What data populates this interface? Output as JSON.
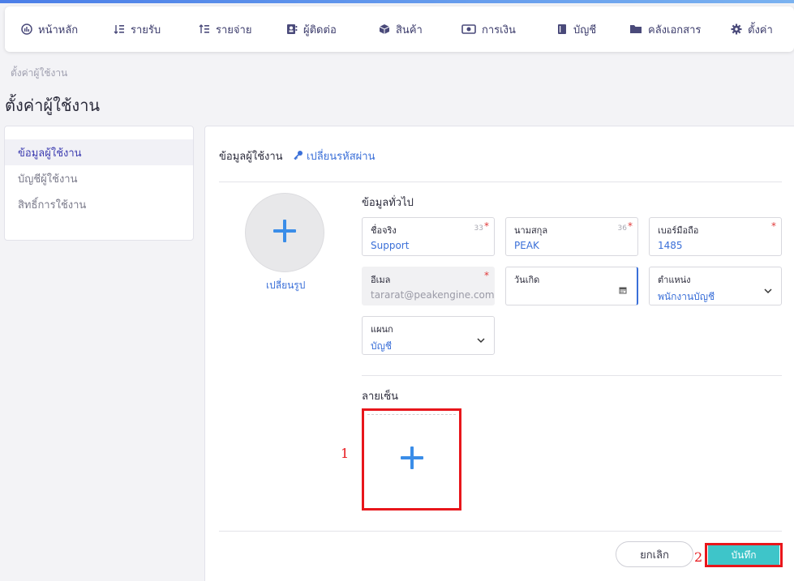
{
  "nav": {
    "items": [
      {
        "label": "หน้าหลัก",
        "icon": "dashboard-icon"
      },
      {
        "label": "รายรับ",
        "icon": "income-list-icon"
      },
      {
        "label": "รายจ่าย",
        "icon": "expense-list-icon"
      },
      {
        "label": "ผู้ติดต่อ",
        "icon": "contacts-icon"
      },
      {
        "label": "สินค้า",
        "icon": "product-box-icon"
      },
      {
        "label": "การเงิน",
        "icon": "money-icon"
      },
      {
        "label": "บัญชี",
        "icon": "ledger-book-icon"
      },
      {
        "label": "คลังเอกสาร",
        "icon": "folder-icon"
      },
      {
        "label": "ตั้งค่า",
        "icon": "gear-icon"
      }
    ]
  },
  "breadcrumb": "ตั้งค่าผู้ใช้งาน",
  "page_title": "ตั้งค่าผู้ใช้งาน",
  "sidebar": {
    "items": [
      {
        "label": "ข้อมูลผู้ใช้งาน"
      },
      {
        "label": "บัญชีผู้ใช้งาน"
      },
      {
        "label": "สิทธิ์การใช้งาน"
      }
    ]
  },
  "card": {
    "title": "ข้อมูลผู้ใช้งาน",
    "change_password": "เปลี่ยนรหัสผ่าน",
    "change_photo": "เปลี่ยนรูป",
    "general_title": "ข้อมูลทั่วไป",
    "signature_title": "ลายเซ็น"
  },
  "form": {
    "first_name": {
      "label": "ชื่อจริง",
      "value": "Support",
      "count": "33"
    },
    "last_name": {
      "label": "นามสกุล",
      "value": "PEAK",
      "count": "36"
    },
    "phone": {
      "label": "เบอร์มือถือ",
      "value": "1485"
    },
    "email": {
      "label": "อีเมล",
      "value": "tararat@peakengine.com"
    },
    "birthday": {
      "label": "วันเกิด",
      "value": ""
    },
    "position": {
      "label": "ตำแหน่ง",
      "value": "พนักงานบัญชี"
    },
    "department": {
      "label": "แผนก",
      "value": "บัญชี"
    },
    "required_mark": "*"
  },
  "annotations": {
    "one": "1",
    "two": "2"
  },
  "buttons": {
    "cancel": "ยกเลิก",
    "save": "บันทึก"
  },
  "colors": {
    "accent": "#3a6fd8",
    "save": "#3ec5c9",
    "highlight": "#e8161b"
  }
}
